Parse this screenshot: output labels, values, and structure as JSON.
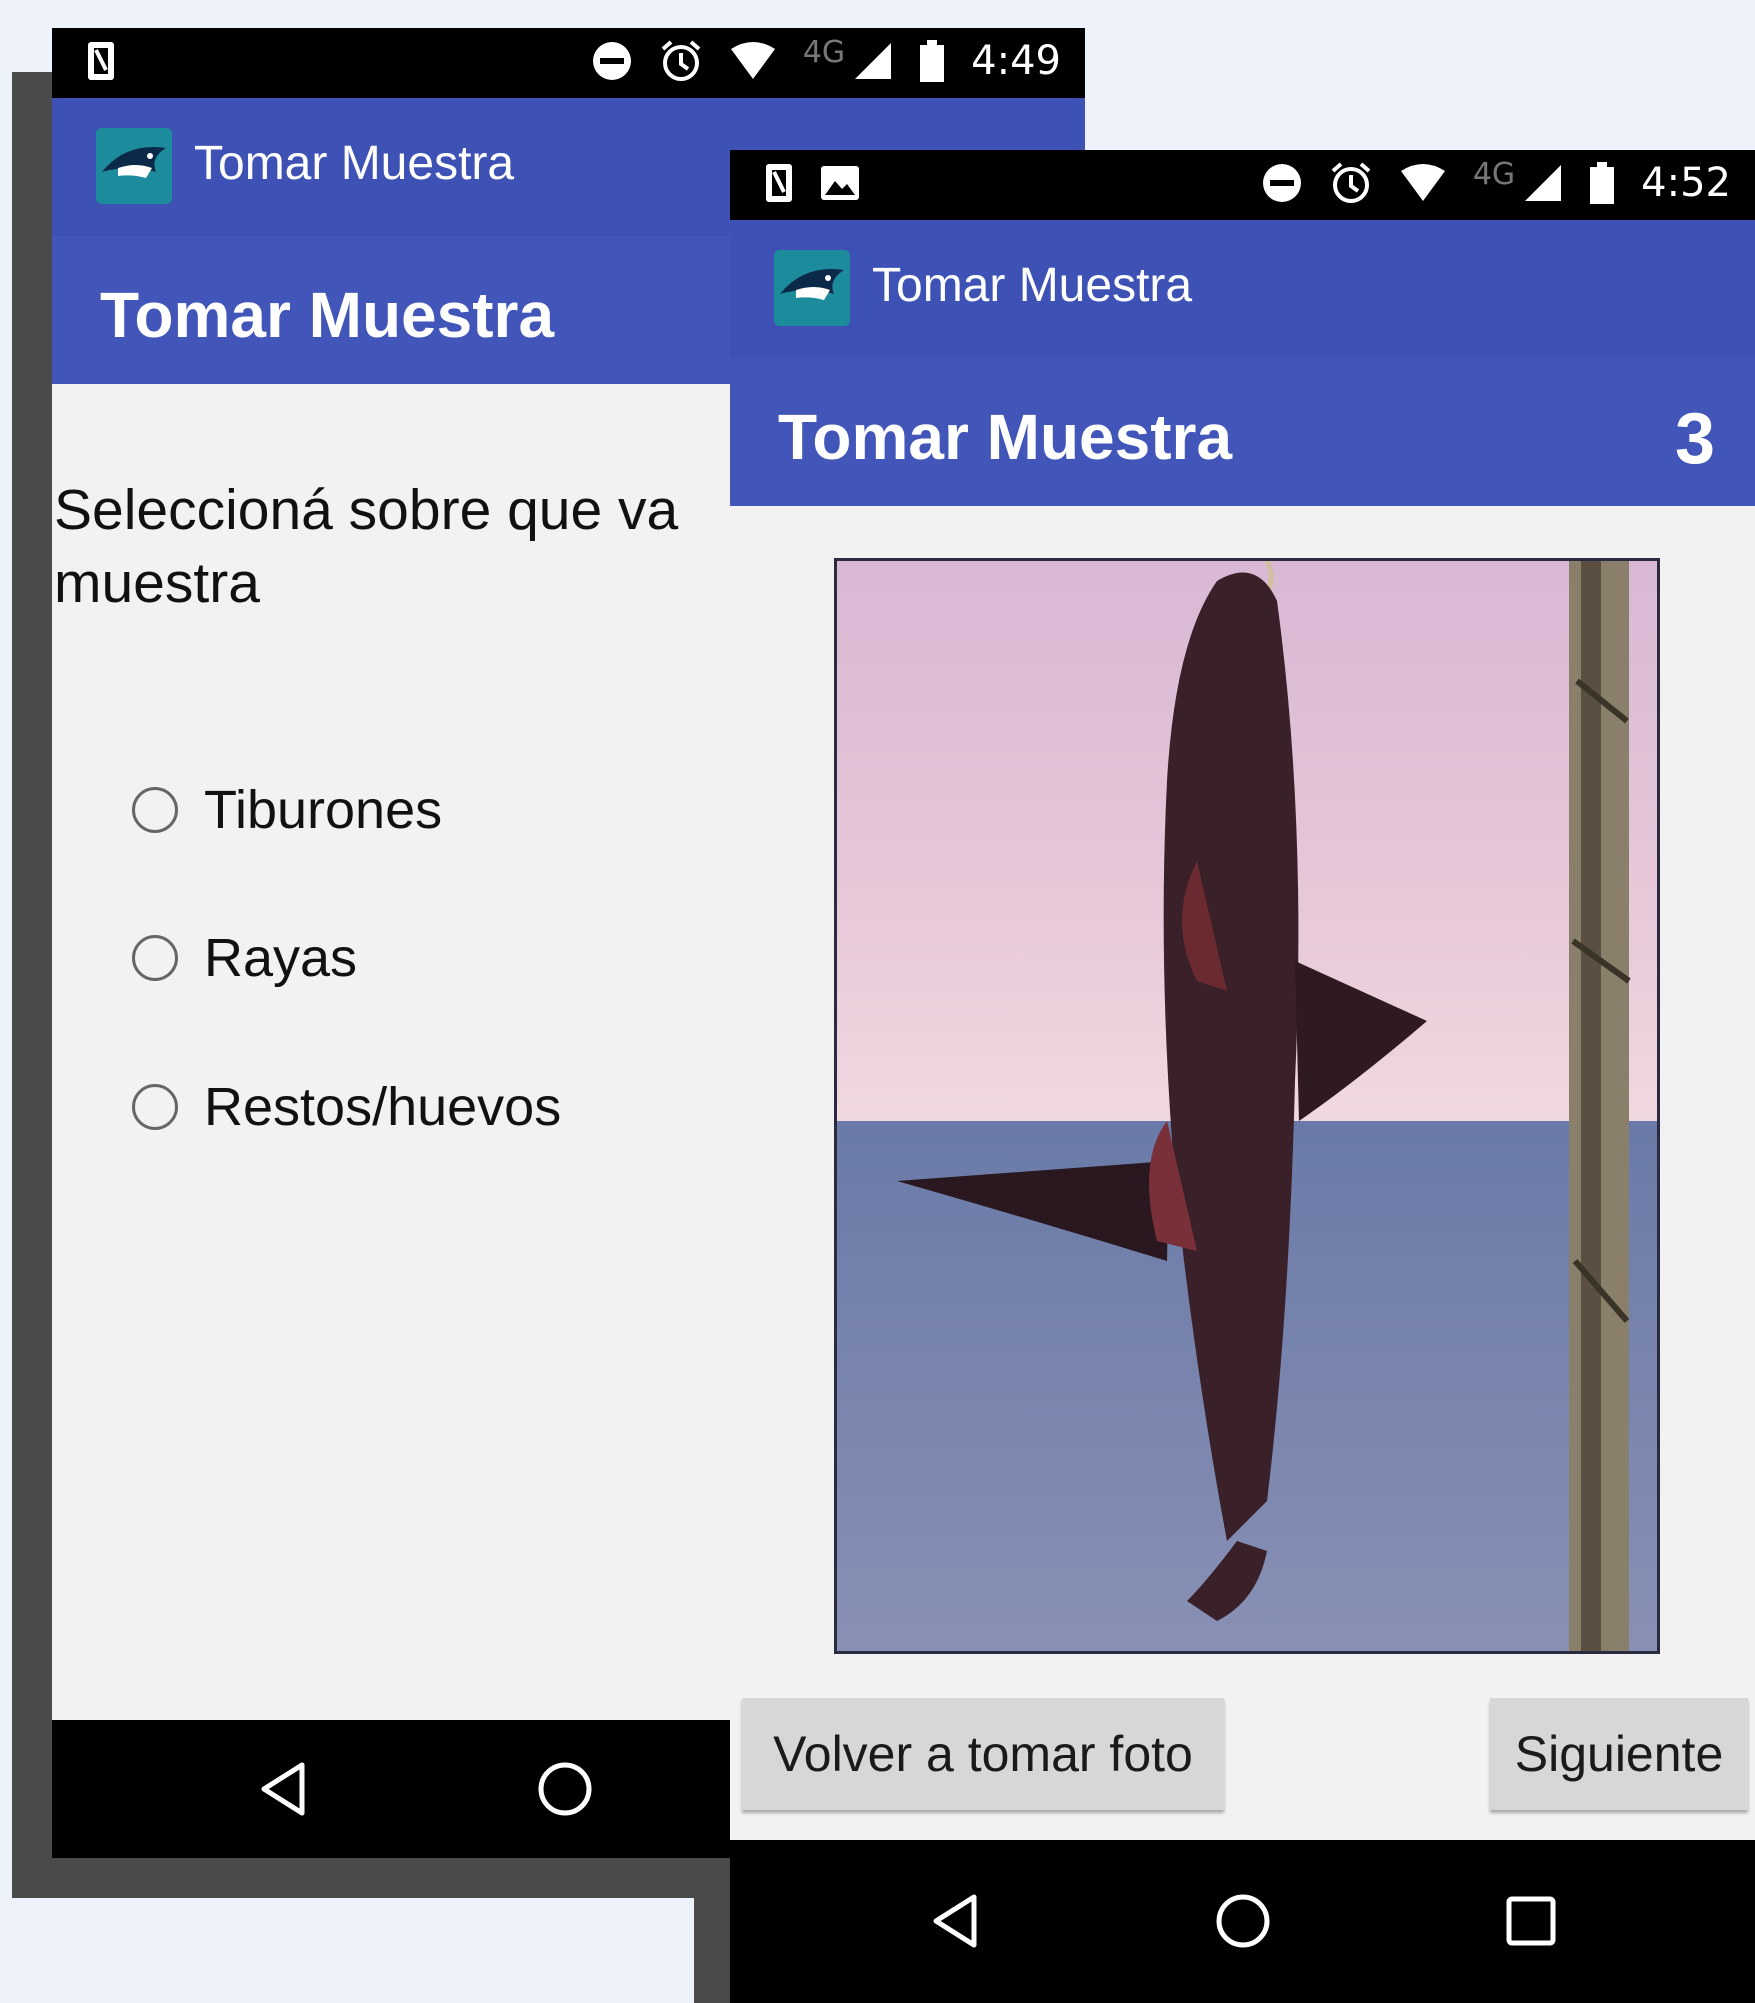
{
  "screens": [
    {
      "status_time": "4:49",
      "status_network": "4G",
      "app_title": "Tomar Muestra",
      "header_title": "Tomar Muestra",
      "prompt": "Seleccioná sobre que va",
      "prompt_line2": "muestra",
      "options": [
        "Tiburones",
        "Rayas",
        "Restos/huevos"
      ]
    },
    {
      "status_time": "4:52",
      "status_network": "4G",
      "app_title": "Tomar Muestra",
      "header_title": "Tomar Muestra",
      "count": "3",
      "buttons": {
        "retake": "Volver a tomar foto",
        "next": "Siguiente"
      }
    }
  ],
  "colors": {
    "app_bar": "#3e51b5",
    "header": "#4156b8",
    "status_bar": "#000000",
    "background": "#f2f2f2"
  },
  "icons": [
    "sim-icon",
    "image-icon",
    "dnd-icon",
    "alarm-icon",
    "wifi-icon",
    "signal-icon",
    "battery-icon",
    "app-logo",
    "back-icon",
    "home-icon",
    "recents-icon"
  ]
}
